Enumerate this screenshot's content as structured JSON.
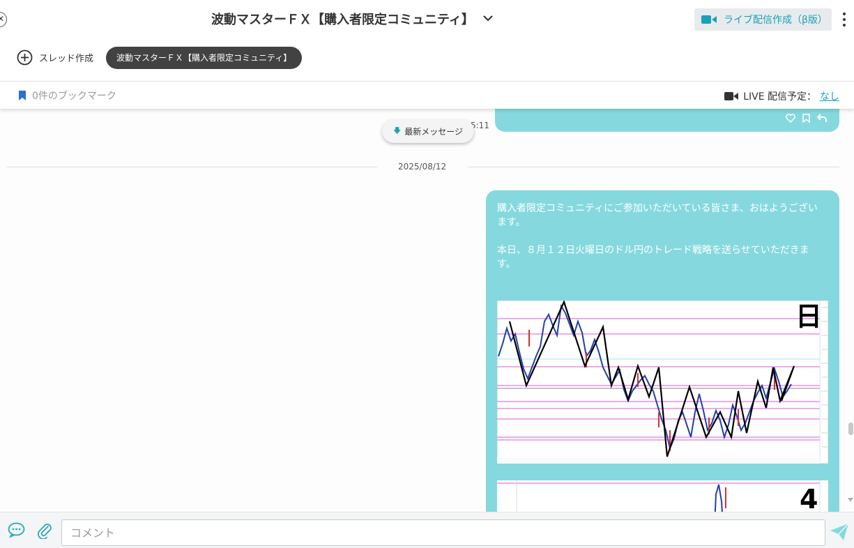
{
  "header": {
    "title": "波動マスターＦＸ【購入者限定コミュニティ】",
    "live_create_label": "ライブ配信作成（β版）"
  },
  "threads": {
    "create_label": "スレッド作成",
    "current_chip": "波動マスターＦＸ【購入者限定コミュニティ】"
  },
  "bookmark_bar": {
    "bookmark_label": "0件のブックマーク",
    "live_schedule_label": "LIVE 配信予定：",
    "live_schedule_value": "なし"
  },
  "feed": {
    "prev_time": "5:11",
    "latest_button_label": "最新メッセージ",
    "date_separator": "2025/08/12",
    "message_text": "購入者限定コミュニティにご参加いただいている皆さま、おはようございます。\n\n本日、８月１２日火曜日のドル円のトレード戦略を送らせていただきます。",
    "chart1_label": "日",
    "chart2_label": "4"
  },
  "composer": {
    "placeholder": "コメント"
  },
  "colors": {
    "accent": "#1aa1b5",
    "bubble": "#85d9de",
    "chip_bg": "#424242"
  },
  "icons": [
    "back-icon",
    "chevron-down-icon",
    "video-camera-icon",
    "kebab-menu-icon",
    "plus-circle-icon",
    "bookmark-icon",
    "heart-icon",
    "reply-icon",
    "arrow-down-icon",
    "chat-bubble-icon",
    "paperclip-icon",
    "send-icon"
  ]
}
